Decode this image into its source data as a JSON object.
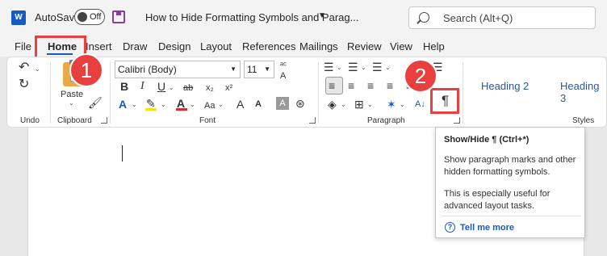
{
  "titlebar": {
    "app_logo": "W",
    "autosave_label": "AutoSave",
    "autosave_state": "Off",
    "document_title": "How to Hide Formatting Symbols and Parag...",
    "search_placeholder": "Search (Alt+Q)"
  },
  "tabs": [
    {
      "label": "File"
    },
    {
      "label": "Home"
    },
    {
      "label": "Insert"
    },
    {
      "label": "Draw"
    },
    {
      "label": "Design"
    },
    {
      "label": "Layout"
    },
    {
      "label": "References"
    },
    {
      "label": "Mailings"
    },
    {
      "label": "Review"
    },
    {
      "label": "View"
    },
    {
      "label": "Help"
    }
  ],
  "active_tab": "Home",
  "ribbon": {
    "groups": {
      "undo": "Undo",
      "clipboard": "Clipboard",
      "font": "Font",
      "paragraph": "Paragraph",
      "styles": "Styles"
    },
    "paste_label": "Paste",
    "font_name": "Calibri (Body)",
    "font_size": "11",
    "styles": [
      "Heading 2",
      "Heading 3"
    ],
    "show_hide_glyph": "¶"
  },
  "callouts": {
    "first": "1",
    "second": "2"
  },
  "tooltip": {
    "title": "Show/Hide ¶ (Ctrl+*)",
    "line1": "Show paragraph marks and other",
    "line2": "hidden formatting symbols.",
    "line3": "This is especially useful for",
    "line4": "advanced layout tasks.",
    "link": "Tell me more"
  },
  "colors": {
    "accent": "#185abd",
    "callout": "#e8403f",
    "highlight_yellow": "#f5e21b",
    "font_red": "#d92b2b",
    "save_purple": "#8b3e9b"
  },
  "icons": [
    "word-logo-icon",
    "save-icon",
    "search-icon",
    "undo-icon",
    "redo-icon",
    "format-painter-icon",
    "pilcrow-icon",
    "help-icon"
  ]
}
